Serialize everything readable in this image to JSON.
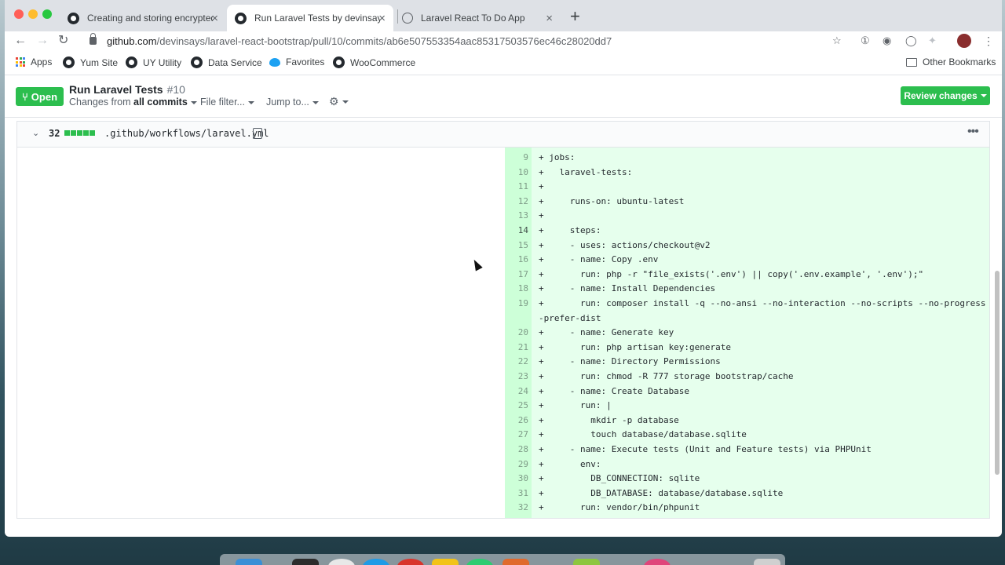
{
  "tabs": [
    {
      "title": "Creating and storing encrypted",
      "icon": "github-icon",
      "active": false
    },
    {
      "title": "Run Laravel Tests by devinsays",
      "icon": "github-icon",
      "active": true
    },
    {
      "title": "Laravel React To Do App",
      "icon": "globe-icon",
      "active": false
    }
  ],
  "address": {
    "host": "github.com",
    "path": "/devinsays/laravel-react-bootstrap/pull/10/commits/ab6e507553354aac85317503576ec46c28020dd7"
  },
  "bookmarks": [
    {
      "label": "Apps",
      "icon": "apps-grid-icon"
    },
    {
      "label": "Yum Site",
      "icon": "github-icon"
    },
    {
      "label": "UY Utility",
      "icon": "github-icon"
    },
    {
      "label": "Data Service",
      "icon": "github-icon"
    },
    {
      "label": "Favorites",
      "icon": "twitter-icon"
    },
    {
      "label": "WooCommerce",
      "icon": "github-icon"
    }
  ],
  "other_bookmarks": "Other Bookmarks",
  "pr": {
    "state": "Open",
    "title": "Run Laravel Tests",
    "number": "#10",
    "changes_prefix": "Changes from",
    "changes_value": "all commits",
    "file_filter": "File filter...",
    "jump_to": "Jump to...",
    "review_button": "Review changes"
  },
  "file": {
    "additions_count": "32",
    "path": ".github/workflows/laravel.yml"
  },
  "diff_lines": [
    {
      "n": "9",
      "code": "+ jobs:"
    },
    {
      "n": "10",
      "code": "+   laravel-tests:"
    },
    {
      "n": "11",
      "code": "+"
    },
    {
      "n": "12",
      "code": "+     runs-on: ubuntu-latest"
    },
    {
      "n": "13",
      "code": "+"
    },
    {
      "n": "14",
      "code": "+     steps:"
    },
    {
      "n": "15",
      "code": "+     - uses: actions/checkout@v2"
    },
    {
      "n": "16",
      "code": "+     - name: Copy .env"
    },
    {
      "n": "17",
      "code": "+       run: php -r \"file_exists('.env') || copy('.env.example', '.env');\""
    },
    {
      "n": "18",
      "code": "+     - name: Install Dependencies"
    },
    {
      "n": "19",
      "code": "+       run: composer install -q --no-ansi --no-interaction --no-scripts --no-progress -"
    },
    {
      "n": "",
      "code": "-prefer-dist"
    },
    {
      "n": "20",
      "code": "+     - name: Generate key"
    },
    {
      "n": "21",
      "code": "+       run: php artisan key:generate"
    },
    {
      "n": "22",
      "code": "+     - name: Directory Permissions"
    },
    {
      "n": "23",
      "code": "+       run: chmod -R 777 storage bootstrap/cache"
    },
    {
      "n": "24",
      "code": "+     - name: Create Database"
    },
    {
      "n": "25",
      "code": "+       run: |"
    },
    {
      "n": "26",
      "code": "+         mkdir -p database"
    },
    {
      "n": "27",
      "code": "+         touch database/database.sqlite"
    },
    {
      "n": "28",
      "code": "+     - name: Execute tests (Unit and Feature tests) via PHPUnit"
    },
    {
      "n": "29",
      "code": "+       env:"
    },
    {
      "n": "30",
      "code": "+         DB_CONNECTION: sqlite"
    },
    {
      "n": "31",
      "code": "+         DB_DATABASE: database/database.sqlite"
    },
    {
      "n": "32",
      "code": "+       run: vendor/bin/phpunit"
    }
  ]
}
